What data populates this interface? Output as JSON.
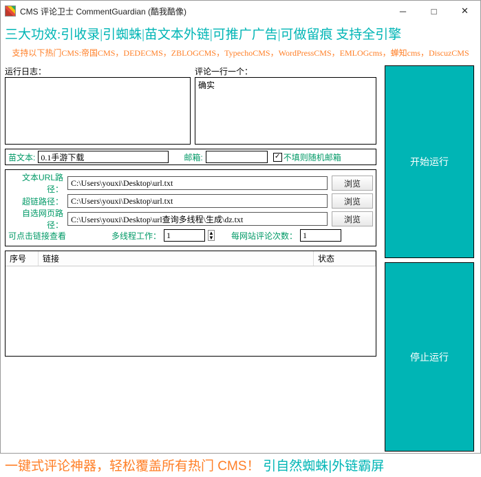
{
  "window": {
    "title": "CMS 评论卫士 CommentGuardian      (酷我酷像)"
  },
  "banner1": "三大功效:引收录|引蜘蛛|苗文本外链|可推广广告|可做留痕  支持全引擎",
  "banner2": "支持以下热门CMS:帝国CMS，DEDECMS，ZBLOGCMS，TypechoCMS，WordPressCMS，EMLOGcms，蝉知cms，DiscuzCMS",
  "labels": {
    "log": "运行日志：",
    "comments": "评论一行一个：",
    "miao": "苗文本:",
    "email": "邮箱:",
    "randomEmail": "不填则随机邮箱",
    "urlPath": "文本URL路径：",
    "linkPath": "超链路径：",
    "selfPath": "自选网页路径：",
    "clickHint": "可点击链接查看",
    "threads": "多线程工作：",
    "perSite": "每网站评论次数：",
    "colNum": "序号",
    "colLink": "链接",
    "colStatus": "状态",
    "browse": "浏览"
  },
  "values": {
    "log": "",
    "comments": "确实",
    "miao": "0.1手游下载",
    "email": "",
    "urlPath": "C:\\Users\\youxi\\Desktop\\url.txt",
    "linkPath": "C:\\Users\\youxi\\Desktop\\url.txt",
    "selfPath": "C:\\Users\\youxi\\Desktop\\url查询多线程\\生成\\dz.txt",
    "threads": "1",
    "perSite": "1",
    "randomEmailChecked": true
  },
  "buttons": {
    "start": "开始运行",
    "stop": "停止运行"
  },
  "footer": {
    "p1": "一键式评论神器，轻松覆盖所有热门 CMS！",
    "p2": "引自然蜘蛛|外链霸屏"
  }
}
